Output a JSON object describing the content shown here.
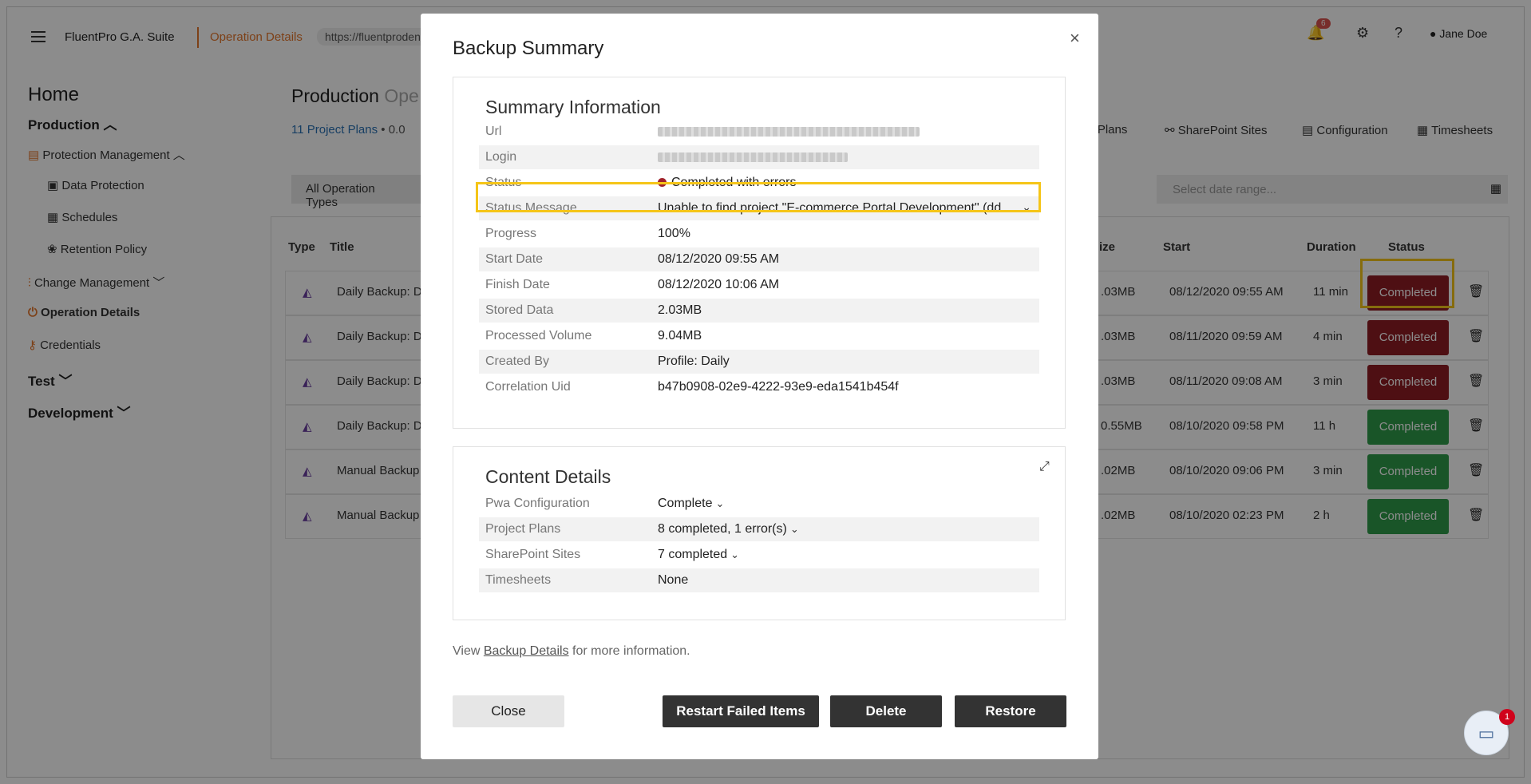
{
  "topbar": {
    "brand": "FluentPro G.A. Suite",
    "breadcrumb": "Operation Details",
    "url_fragment": "https://fluentproden",
    "notifications_count": "6",
    "user_name": "Jane Doe"
  },
  "sidebar": {
    "home": "Home",
    "production": "Production",
    "protection_management": "Protection Management",
    "data_protection": "Data Protection",
    "schedules": "Schedules",
    "retention_policy": "Retention Policy",
    "change_management": "Change Management",
    "operation_details": "Operation Details",
    "credentials": "Credentials",
    "test": "Test",
    "development": "Development"
  },
  "main": {
    "title": "Production",
    "title_muted": "Ope",
    "project_plans_link": "11 Project Plans",
    "meta_fragment": "• 0.0",
    "filter_label": "All Operation Types",
    "date_placeholder": "Select date range...",
    "links": {
      "project_plans": "ct Plans",
      "sharepoint_sites": "SharePoint Sites",
      "configuration": "Configuration",
      "timesheets": "Timesheets"
    },
    "columns": {
      "type": "Type",
      "title": "Title",
      "size": "ize",
      "start": "Start",
      "duration": "Duration",
      "status": "Status"
    },
    "rows": [
      {
        "title": "Daily Backup: Da",
        "size": ".03MB",
        "start": "08/12/2020 09:55 AM",
        "duration": "11 min",
        "status": "Completed",
        "status_color": "#8f1d24"
      },
      {
        "title": "Daily Backup: Da",
        "size": ".03MB",
        "start": "08/11/2020 09:59 AM",
        "duration": "4 min",
        "status": "Completed",
        "status_color": "#8f1d24"
      },
      {
        "title": "Daily Backup: Da",
        "size": ".03MB",
        "start": "08/11/2020 09:08 AM",
        "duration": "3 min",
        "status": "Completed",
        "status_color": "#8f1d24"
      },
      {
        "title": "Daily Backup: Da",
        "size": "0.55MB",
        "start": "08/10/2020 09:58 PM",
        "duration": "11 h",
        "status": "Completed",
        "status_color": "#2e9b49"
      },
      {
        "title": "Manual Backup",
        "size": ".02MB",
        "start": "08/10/2020 09:06 PM",
        "duration": "3 min",
        "status": "Completed",
        "status_color": "#2e9b49"
      },
      {
        "title": "Manual Backup",
        "size": ".02MB",
        "start": "08/10/2020 02:23 PM",
        "duration": "2 h",
        "status": "Completed",
        "status_color": "#2e9b49"
      }
    ]
  },
  "modal": {
    "title": "Backup Summary",
    "close_glyph": "×",
    "summary": {
      "heading": "Summary Information",
      "fields": [
        {
          "key": "Url",
          "value": ""
        },
        {
          "key": "Login",
          "value": ""
        },
        {
          "key": "Status",
          "value": "Completed with errors"
        },
        {
          "key": "Status Message",
          "value": "Unable to find project \"E-commerce Portal Development\" (dd..."
        },
        {
          "key": "Progress",
          "value": "100%"
        },
        {
          "key": "Start Date",
          "value": "08/12/2020 09:55 AM"
        },
        {
          "key": "Finish Date",
          "value": "08/12/2020 10:06 AM"
        },
        {
          "key": "Stored Data",
          "value": "2.03MB"
        },
        {
          "key": "Processed Volume",
          "value": "9.04MB"
        },
        {
          "key": "Created By",
          "value": "Profile: Daily"
        },
        {
          "key": "Correlation Uid",
          "value": "b47b0908-02e9-4222-93e9-eda1541b454f"
        }
      ]
    },
    "content": {
      "heading": "Content Details",
      "fields": [
        {
          "key": "Pwa Configuration",
          "value": "Complete"
        },
        {
          "key": "Project Plans",
          "value": "8 completed, 1 error(s)"
        },
        {
          "key": "SharePoint Sites",
          "value": "7 completed"
        },
        {
          "key": "Timesheets",
          "value": "None"
        }
      ]
    },
    "footnote": {
      "prefix": "View ",
      "link": "Backup Details",
      "suffix": " for more information."
    },
    "buttons": {
      "close": "Close",
      "restart": "Restart Failed Items",
      "delete": "Delete",
      "restore": "Restore"
    }
  },
  "chat": {
    "badge": "1"
  },
  "colors": {
    "accent_orange": "#e4762b",
    "status_error": "#8f1d24",
    "status_ok": "#2e9b49",
    "highlight": "#f5c518"
  }
}
